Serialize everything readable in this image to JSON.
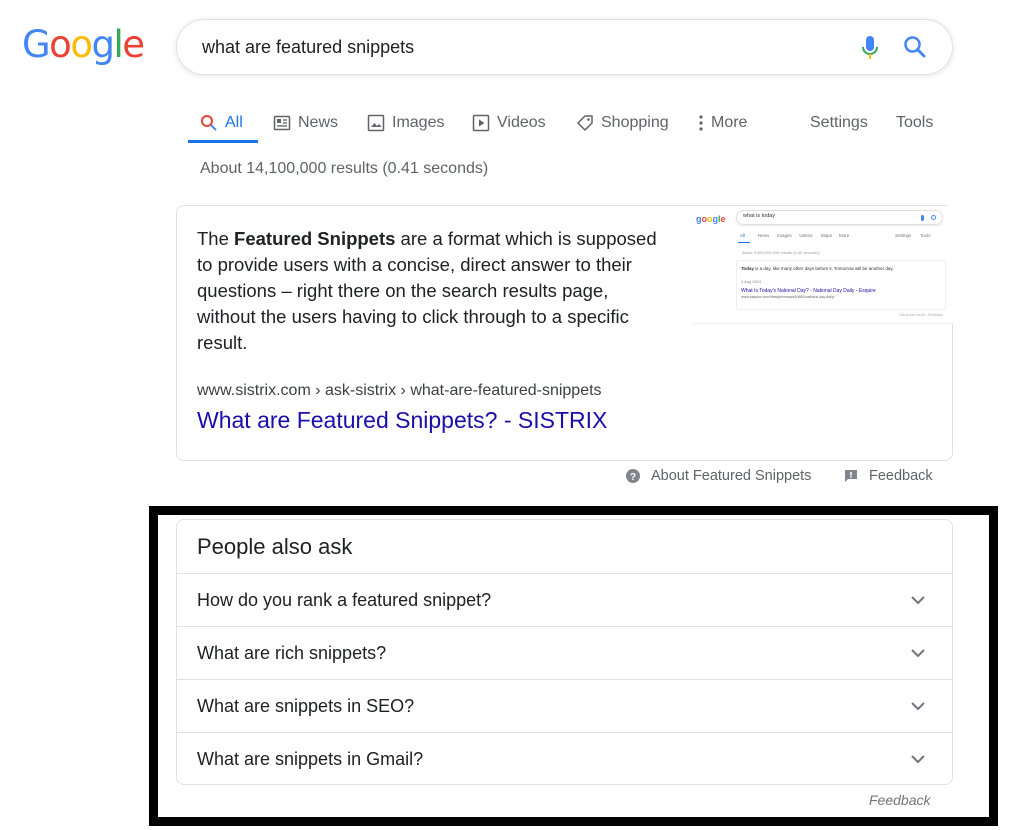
{
  "logo": {
    "letters": [
      "G",
      "o",
      "o",
      "g",
      "l",
      "e"
    ],
    "colors": [
      "#4285f4",
      "#ea4335",
      "#fbbc05",
      "#4285f4",
      "#34a853",
      "#ea4335"
    ]
  },
  "search": {
    "query": "what are featured snippets"
  },
  "tabs": [
    {
      "label": "All",
      "icon": "search-icon",
      "active": true
    },
    {
      "label": "News",
      "icon": "news-icon"
    },
    {
      "label": "Images",
      "icon": "image-icon"
    },
    {
      "label": "Videos",
      "icon": "play-icon"
    },
    {
      "label": "Shopping",
      "icon": "tag-icon"
    },
    {
      "label": "More",
      "icon": "more-vert-icon"
    },
    {
      "label": "Settings"
    },
    {
      "label": "Tools"
    }
  ],
  "result_stats": "About 14,100,000 results (0.41 seconds)",
  "snippet": {
    "text_before": "The ",
    "text_bold": "Featured Snippets",
    "text_after": " are a format which is supposed to provide users with a concise, direct answer to their questions – right there on the search results page, without the users having to click through to a specific result.",
    "url": "www.sistrix.com › ask-sistrix › what-are-featured-snippets",
    "link_title": "What are Featured Snippets? - SISTRIX",
    "thumbnail": {
      "query": "what is today",
      "tabs": [
        "All",
        "News",
        "Images",
        "Videos",
        "Maps",
        "More",
        "Settings",
        "Tools"
      ],
      "stats": "About 3,000,000,000 results (0.40 seconds)",
      "answer_bold": "Today",
      "answer_rest": " is a day, like many other days before it. Tomorrow will be another day.",
      "date": "3 Aug 2019",
      "link": "What Is Today's National Day? - National Day Daily - Esquire",
      "url": "www.esquire.com/lifestyle/news/a30882/national-day-daily/",
      "about": "About this result • Feedback"
    }
  },
  "snippet_footer": {
    "about": "About Featured Snippets",
    "feedback": "Feedback"
  },
  "paa": {
    "title": "People also ask",
    "questions": [
      "How do you rank a featured snippet?",
      "What are rich snippets?",
      "What are snippets in SEO?",
      "What are snippets in Gmail?"
    ],
    "feedback": "Feedback"
  }
}
